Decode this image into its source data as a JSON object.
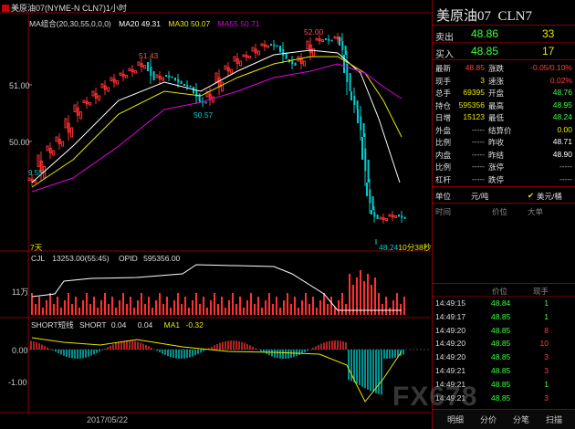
{
  "header": {
    "title": "美原油07(NYME-N CLN7)1小时",
    "ma_group": "MA组合(20,30,55,0,0,0)",
    "ma20_label": "MA20",
    "ma20": "49.31",
    "ma30_label": "MA30",
    "ma30": "50.07",
    "ma55_label": "MA55",
    "ma55": "50.71"
  },
  "price_axis": [
    "51.00",
    "50.00",
    "9.55"
  ],
  "price_annotations": {
    "high": "52.00",
    "p1": "51.43",
    "p2": "50.57",
    "low": "48.24",
    "low_tag": "10分38秒",
    "left_marker": "7天"
  },
  "volume_header": {
    "cjl": "CJL",
    "cjl_val": "13253.00(55:45)",
    "opid": "OPID",
    "opid_val": "595356.00"
  },
  "volume_axis": "11万",
  "osc_header": {
    "name": "SHORT短线",
    "short_label": "SHORT",
    "short": "0.04",
    "v2": "0.04",
    "ma1_label": "MA1",
    "ma1": "-0.32"
  },
  "osc_axis": [
    "0.00",
    "-1.00"
  ],
  "date_label": "2017/05/22",
  "quote": {
    "name": "美原油07",
    "code": "CLN7",
    "sell_label": "卖出",
    "sell_price": "48.86",
    "sell_qty": "33",
    "buy_label": "买入",
    "buy_price": "48.85",
    "buy_qty": "17",
    "stats": [
      {
        "l1": "最新",
        "v1": "48.85",
        "c1": "#ff4040",
        "l2": "涨跌",
        "v2": "-0.05/0.10%",
        "c2": "#ff4040"
      },
      {
        "l1": "现手",
        "v1": "3",
        "c1": "#e8e800",
        "l2": "速涨",
        "v2": "0.02%",
        "c2": "#ff4040"
      },
      {
        "l1": "总手",
        "v1": "69395",
        "c1": "#e8e800",
        "l2": "开盘",
        "v2": "48.76",
        "c2": "#40ff40"
      },
      {
        "l1": "持仓",
        "v1": "595356",
        "c1": "#e8e800",
        "l2": "最高",
        "v2": "48.95",
        "c2": "#40ff40"
      },
      {
        "l1": "日增",
        "v1": "15123",
        "c1": "#e8e800",
        "l2": "最低",
        "v2": "48.24",
        "c2": "#40ff40"
      },
      {
        "l1": "外盘",
        "v1": "-----",
        "c1": "#bbbbbb",
        "l2": "结算价",
        "v2": "0.00",
        "c2": "#e8e800"
      },
      {
        "l1": "比例",
        "v1": "-----",
        "c1": "#bbbbbb",
        "l2": "昨收",
        "v2": "48.71",
        "c2": "#ffffff"
      },
      {
        "l1": "内盘",
        "v1": "-----",
        "c1": "#bbbbbb",
        "l2": "昨结",
        "v2": "48.90",
        "c2": "#ffffff"
      },
      {
        "l1": "比例",
        "v1": "-----",
        "c1": "#bbbbbb",
        "l2": "涨停",
        "v2": "-----",
        "c2": "#bbbbbb"
      },
      {
        "l1": "杠杆",
        "v1": "-----",
        "c1": "#bbbbbb",
        "l2": "跌停",
        "v2": "-----",
        "c2": "#bbbbbb"
      }
    ],
    "unit_label": "单位",
    "unit_value": "元/吨",
    "unit_option": "美元/桶",
    "trades_header": {
      "time": "时间",
      "price": "价位",
      "qty": "大单"
    },
    "ticks_header": {
      "price": "价位",
      "qty": "现手"
    },
    "ticks": [
      {
        "time": "14:49:15",
        "price": "48.84",
        "qty": "1",
        "qc": "#40ff40"
      },
      {
        "time": "14:49:17",
        "price": "48.85",
        "qty": "1",
        "qc": "#40ff40"
      },
      {
        "time": "14:49:20",
        "price": "48.85",
        "qty": "8",
        "qc": "#ff4040"
      },
      {
        "time": "14:49:20",
        "price": "48.85",
        "qty": "10",
        "qc": "#ff4040"
      },
      {
        "time": "14:49:20",
        "price": "48.85",
        "qty": "3",
        "qc": "#ff4040"
      },
      {
        "time": "14:49:21",
        "price": "48.85",
        "qty": "3",
        "qc": "#ff4040"
      },
      {
        "time": "14:49:21",
        "price": "48.85",
        "qty": "1",
        "qc": "#40ff40"
      },
      {
        "time": "14:49:21",
        "price": "48.85",
        "qty": "3",
        "qc": "#ff4040"
      }
    ],
    "tabs": [
      "明细",
      "分价",
      "分笔",
      "扫描"
    ]
  },
  "watermark": "FX678",
  "colors": {
    "up": "#ff3030",
    "down": "#00cfcf",
    "ma20": "#ffffff",
    "ma30": "#e8e800",
    "ma55": "#e000e0",
    "frame": "#8b0000"
  }
}
